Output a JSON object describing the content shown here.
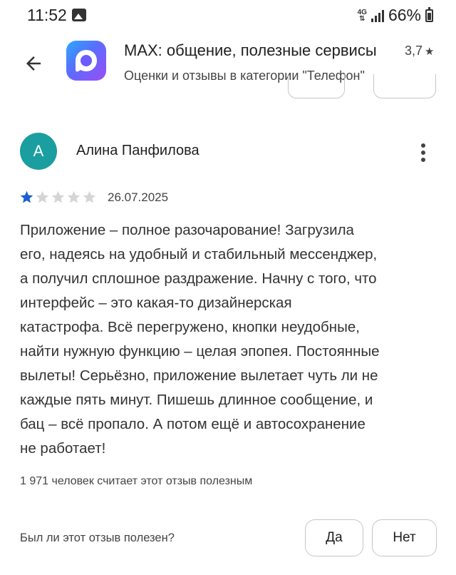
{
  "status_bar": {
    "time": "11:52",
    "network": "4G",
    "battery_percent": "66%",
    "icons": [
      "gallery-icon",
      "signal-icon",
      "battery-icon"
    ]
  },
  "header": {
    "back_icon": "arrow-left-icon",
    "app_icon": "max-app-icon",
    "app_title": "MAX: общение, полезные сервисы",
    "app_rating": "3,7",
    "rating_star_icon": "star-icon",
    "subtitle": "Оценки и отзывы в категории \"Телефон\""
  },
  "review": {
    "avatar_letter": "А",
    "avatar_color": "#1a9ea0",
    "author": "Алина Панфилова",
    "menu_icon": "more-vert-icon",
    "rating": 1,
    "max_rating": 5,
    "star_filled_color": "#1a5fd0",
    "star_empty_color": "#d5d5d5",
    "date": "26.07.2025",
    "text_lines": [
      "Приложение – полное разочарование! Загрузила",
      "его, надеясь на удобный и стабильный мессенджер,",
      "а получил сплошное раздражение. Начну с того, что",
      "интерфейс – это какая-то дизайнерская",
      "катастрофа. Всё перегружено, кнопки неудобные,",
      "найти нужную функцию – целая эпопея. Постоянные",
      "вылеты! Серьёзно, приложение вылетает чуть ли не",
      "каждые пять минут. Пишешь длинное сообщение, и",
      "бац – всё пропало. А потом ещё и автосохранение",
      "не работает!"
    ],
    "helpful_count": "1 971 человек считает этот отзыв полезным",
    "helpful_question": "Был ли этот отзыв полезен?",
    "yes_label": "Да",
    "no_label": "Нет"
  }
}
